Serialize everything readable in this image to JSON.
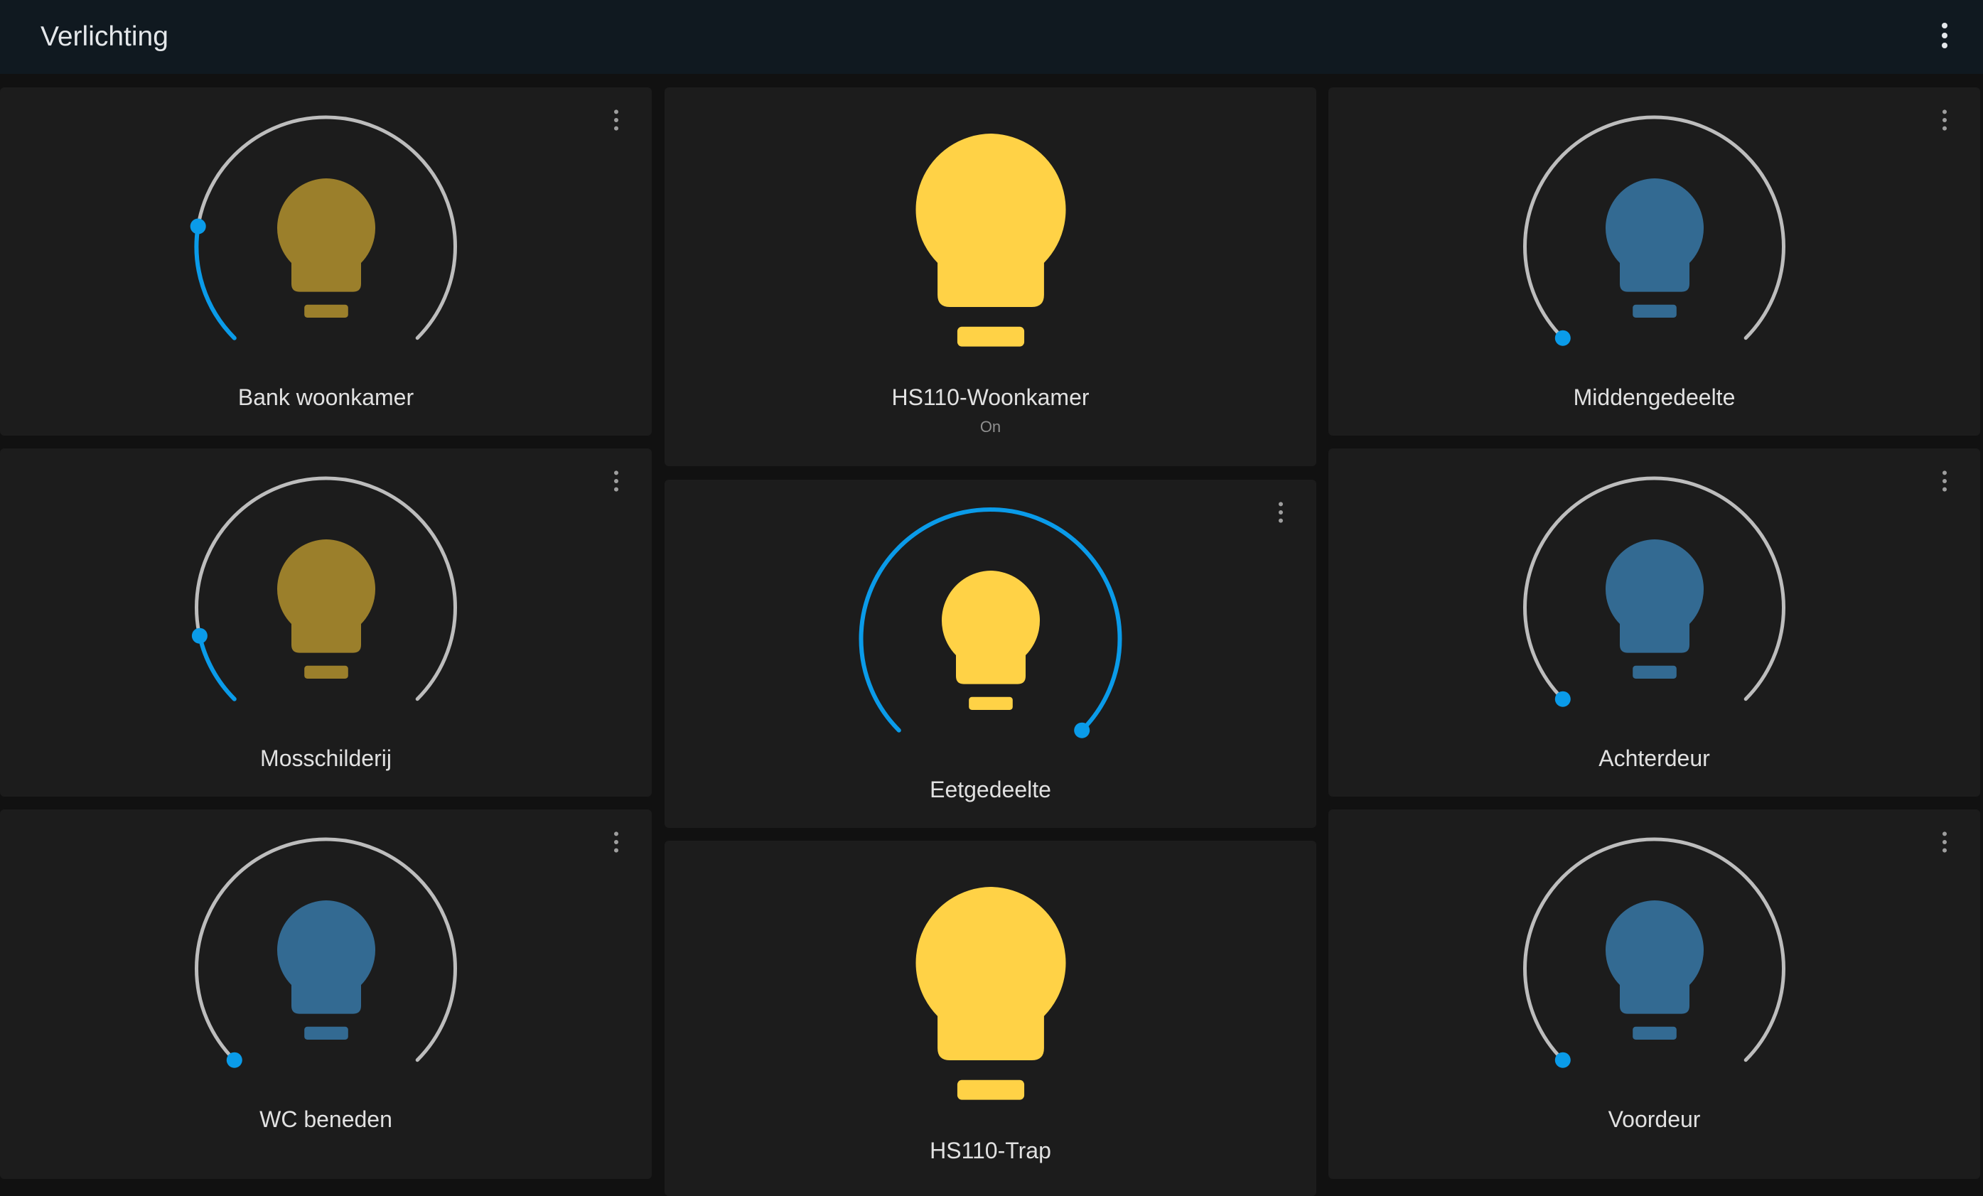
{
  "header": {
    "title": "Verlichting",
    "menu_icon": "dots-vertical-icon"
  },
  "colors": {
    "header_bg": "#101920",
    "card_bg": "#1c1c1c",
    "accent": "#0a9be9",
    "track": "#bdbdbd",
    "bulb_on": "#ffd246",
    "bulb_dim": "#9b7f2b",
    "bulb_off": "#336a92"
  },
  "cards": [
    {
      "name": "Bank woonkamer",
      "type": "dimmer",
      "state": "on",
      "brightness_pct": 20,
      "card_menu_icon": "dots-vertical-icon",
      "bulb_icon": "lightbulb-icon"
    },
    {
      "name": "HS110-Woonkamer",
      "type": "switch",
      "state": "on",
      "state_label": "On",
      "bulb_icon": "lightbulb-icon"
    },
    {
      "name": "Middengedeelte",
      "type": "dimmer",
      "state": "off",
      "brightness_pct": 0,
      "card_menu_icon": "dots-vertical-icon",
      "bulb_icon": "lightbulb-icon"
    },
    {
      "name": "Mosschilderij",
      "type": "dimmer",
      "state": "on",
      "brightness_pct": 12,
      "card_menu_icon": "dots-vertical-icon",
      "bulb_icon": "lightbulb-icon"
    },
    {
      "name": "Eetgedeelte",
      "type": "dimmer",
      "state": "on",
      "brightness_pct": 100,
      "card_menu_icon": "dots-vertical-icon",
      "bulb_icon": "lightbulb-icon"
    },
    {
      "name": "Achterdeur",
      "type": "dimmer",
      "state": "off",
      "brightness_pct": 0,
      "card_menu_icon": "dots-vertical-icon",
      "bulb_icon": "lightbulb-icon"
    },
    {
      "name": "WC beneden",
      "type": "dimmer",
      "state": "off",
      "brightness_pct": 0,
      "card_menu_icon": "dots-vertical-icon",
      "bulb_icon": "lightbulb-icon"
    },
    {
      "name": "HS110-Trap",
      "type": "switch",
      "state": "on",
      "bulb_icon": "lightbulb-icon"
    },
    {
      "name": "Voordeur",
      "type": "dimmer",
      "state": "off",
      "brightness_pct": 0,
      "card_menu_icon": "dots-vertical-icon",
      "bulb_icon": "lightbulb-icon"
    }
  ]
}
